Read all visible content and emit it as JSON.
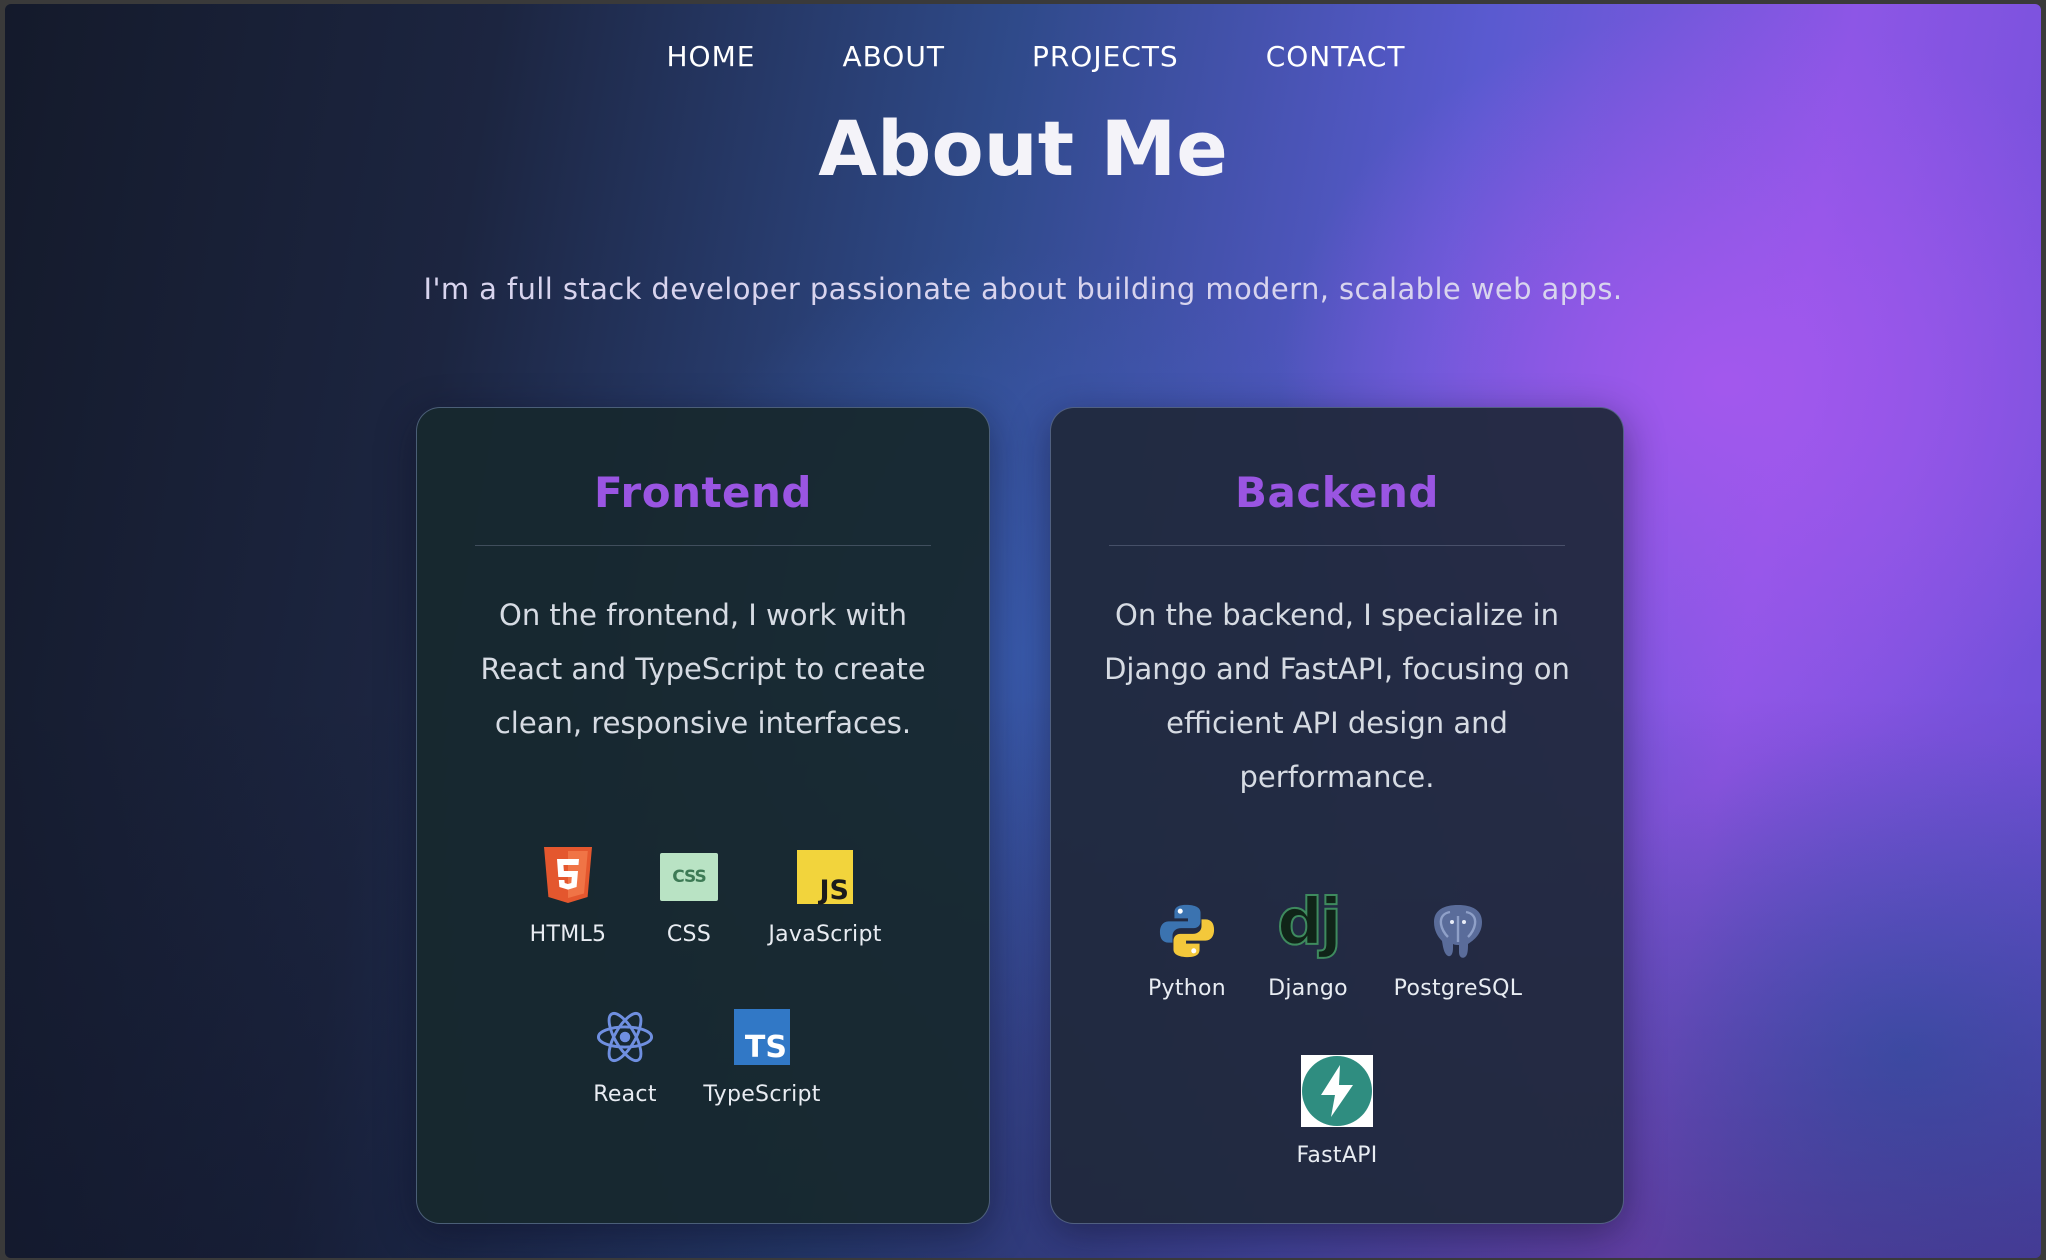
{
  "nav": {
    "items": [
      "HOME",
      "ABOUT",
      "PROJECTS",
      "CONTACT"
    ]
  },
  "header": {
    "title": "About Me",
    "intro": "I'm a full stack developer passionate about building modern, scalable web apps."
  },
  "cards": {
    "frontend": {
      "title": "Frontend",
      "description": "On the frontend, I work with React and TypeScript to create clean, responsive interfaces.",
      "techs": [
        {
          "label": "HTML5",
          "icon": "html5-icon"
        },
        {
          "label": "CSS",
          "icon": "css-icon",
          "glyph": "CSS"
        },
        {
          "label": "JavaScript",
          "icon": "javascript-icon",
          "glyph": "JS"
        },
        {
          "label": "React",
          "icon": "react-icon"
        },
        {
          "label": "TypeScript",
          "icon": "typescript-icon",
          "glyph": "TS"
        }
      ]
    },
    "backend": {
      "title": "Backend",
      "description": "On the backend, I specialize in Django and FastAPI, focusing on efficient API design and performance.",
      "techs": [
        {
          "label": "Python",
          "icon": "python-icon"
        },
        {
          "label": "Django",
          "icon": "django-icon",
          "glyph": "dj"
        },
        {
          "label": "PostgreSQL",
          "icon": "postgresql-icon"
        },
        {
          "label": "FastAPI",
          "icon": "fastapi-icon"
        }
      ]
    }
  },
  "colors": {
    "accent": "#9a55e2",
    "card_border": "#7a8cb4",
    "text": "#f2f2f5"
  }
}
